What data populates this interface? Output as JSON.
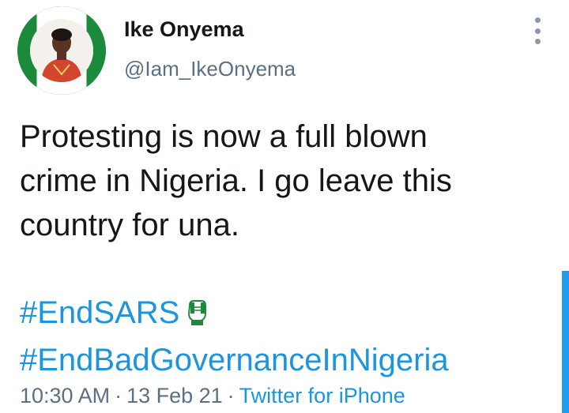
{
  "tweet": {
    "author": {
      "display_name": "Ike Onyema",
      "handle": "@Iam_IkeOnyema",
      "avatar_tag": "#Nigerian"
    },
    "text_lines": [
      "Protesting is now a full blown",
      "crime in Nigeria. I go leave this",
      "country for una."
    ],
    "hashtags": [
      "#EndSARS",
      "#EndBadGovernanceInNigeria"
    ],
    "emoji_icon": "nigeria-fist-icon",
    "time": "10:30 AM",
    "date": "13 Feb 21",
    "source": "Twitter for iPhone",
    "separator": "·"
  },
  "colors": {
    "link": "#1b95e0",
    "secondary": "#5b7083",
    "nigeria_green": "#1b8a3b",
    "scrollbar": "#1d9bf0"
  }
}
